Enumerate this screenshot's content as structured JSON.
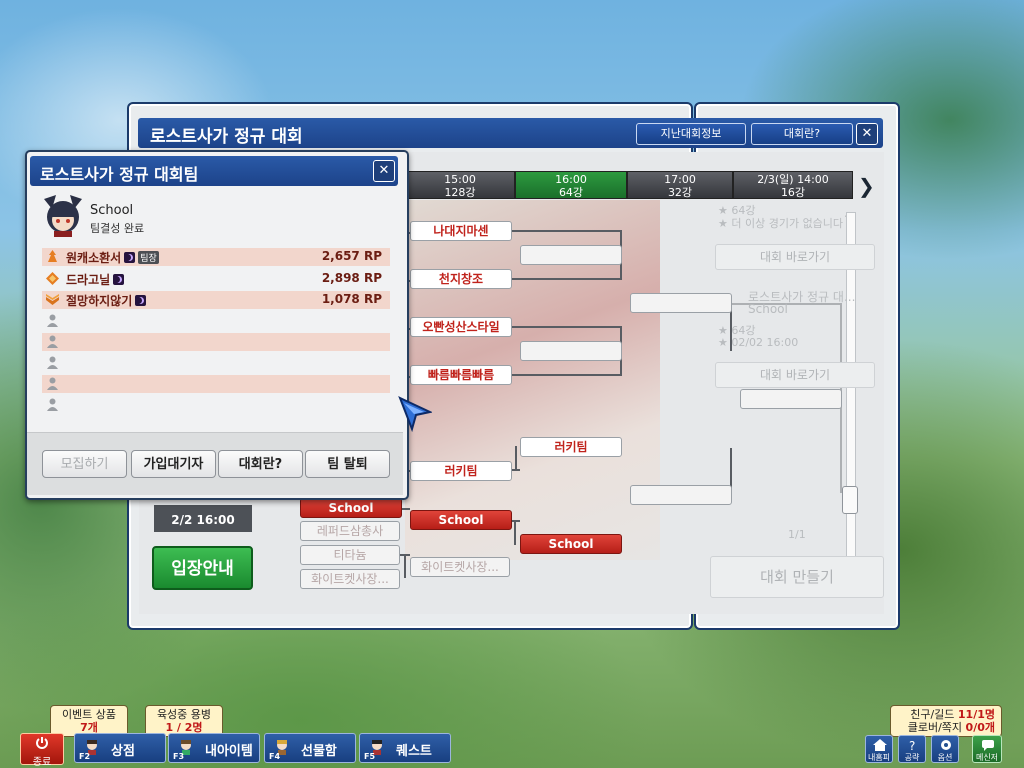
{
  "window": {
    "title": "로스트사가 정규 대회",
    "past_info_button": "지난대회정보",
    "about_button": "대회란?",
    "close": "✕"
  },
  "timeline": [
    {
      "time": "15:00",
      "round": "128강",
      "active": false
    },
    {
      "time": "16:00",
      "round": "64강",
      "active": true
    },
    {
      "time": "17:00",
      "round": "32강",
      "active": false
    },
    {
      "time": "2/3(일) 14:00",
      "round": "16강",
      "active": false
    }
  ],
  "timeline_next": "❯",
  "bracket": {
    "round64": [
      "나대지마센",
      "천지창조",
      "오빤성산스타일",
      "빠름빠름빠름",
      "러키팀"
    ],
    "round32": [
      "러키팀"
    ],
    "school_group": {
      "entries": [
        "School",
        "레퍼드삼총사",
        "티타늄",
        "화이트켓사장..."
      ],
      "winners": [
        "School",
        "화이트켓사장..."
      ],
      "final": "School"
    }
  },
  "left_column": {
    "date": "2/2 16:00",
    "entry_button": "입장안내"
  },
  "side_window": {
    "faded_lines": [
      "★ 64강",
      "★ 더 이상 경기가 없습니다",
      "대회 바로가기",
      "로스트사가 정규 대...",
      "School",
      "★ 64강",
      "★ 02/02 16:00",
      "대회 바로가기",
      "1/1",
      "대회 만들기"
    ]
  },
  "team_popup": {
    "title": "로스트사가 정규 대회팀",
    "close": "✕",
    "team_name": "School",
    "team_status": "팀결성 완료",
    "members": [
      {
        "name": "원캐소환서",
        "rp": "2,657 RP",
        "leader": true,
        "leader_tag": "팀장"
      },
      {
        "name": "드라고닐",
        "rp": "2,898 RP",
        "leader": false
      },
      {
        "name": "절망하지않기",
        "rp": "1,078 RP",
        "leader": false
      }
    ],
    "empty_slots": 5,
    "buttons": {
      "recruit": "모집하기",
      "waitlist": "가입대기자",
      "about": "대회란?",
      "leave": "팀 탈퇴"
    }
  },
  "bottom_bar": {
    "quit": "종료",
    "tips": {
      "event_title": "이벤트 상품",
      "event_count": "7개",
      "merc_title": "육성중 용병",
      "merc_count": "1 / 2명",
      "friends_label": "친구/길드",
      "friends_value": "11/1명",
      "clover_label": "클로버/쪽지",
      "clover_value": "0/0개"
    },
    "buttons": [
      {
        "fkey": "F2",
        "label": "상점"
      },
      {
        "fkey": "F3",
        "label": "내아이템"
      },
      {
        "fkey": "F4",
        "label": "선물함"
      },
      {
        "fkey": "F5",
        "label": "퀘스트"
      }
    ],
    "small_buttons": [
      "내홈피",
      "공략",
      "옵션",
      "메신저"
    ]
  },
  "colors": {
    "title_blue": "#1d438a",
    "accent_green": "#1a8a2f",
    "bracket_red": "#c0231c"
  }
}
